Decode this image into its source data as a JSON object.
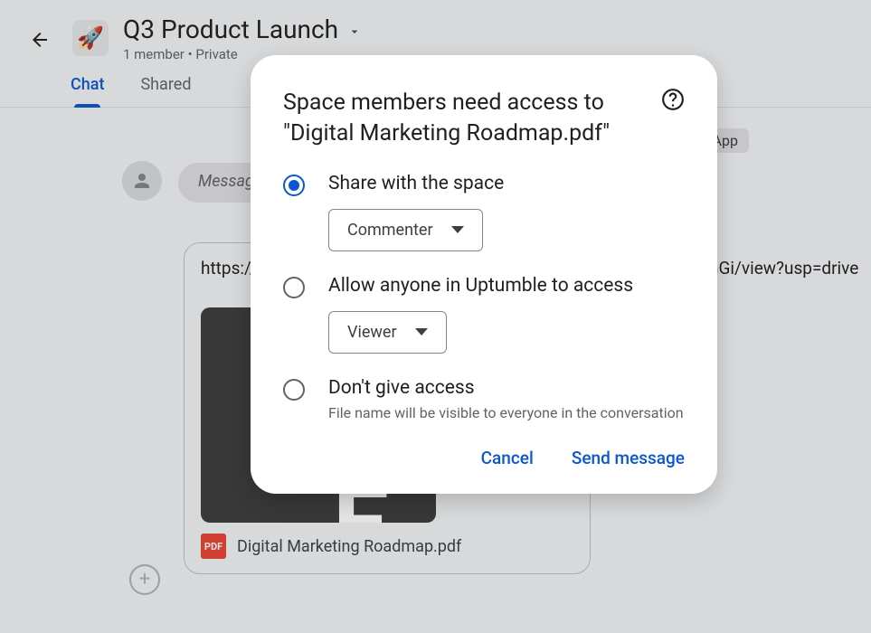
{
  "header": {
    "space_title": "Q3 Product Launch",
    "subtitle": "1 member  •  Private"
  },
  "tabs": {
    "chat": "Chat",
    "shared": "Shared"
  },
  "chip_label": "App",
  "message_placeholder": "Message",
  "attachment": {
    "url_left": "https://",
    "url_right": "hGi/view?usp=drive",
    "file_name": "Digital Marketing Roadmap.pdf",
    "pdf_badge": "PDF"
  },
  "modal": {
    "title": "Space members need access to \"Digital Marketing Roadmap.pdf\"",
    "options": {
      "share_space": {
        "label": "Share with the space",
        "dropdown": "Commenter",
        "selected": true
      },
      "anyone_org": {
        "label": "Allow anyone in Uptumble to access",
        "dropdown": "Viewer"
      },
      "no_access": {
        "label": "Don't give access",
        "hint": "File name will be visible to everyone in the conversation"
      }
    },
    "actions": {
      "cancel": "Cancel",
      "send": "Send message"
    }
  }
}
